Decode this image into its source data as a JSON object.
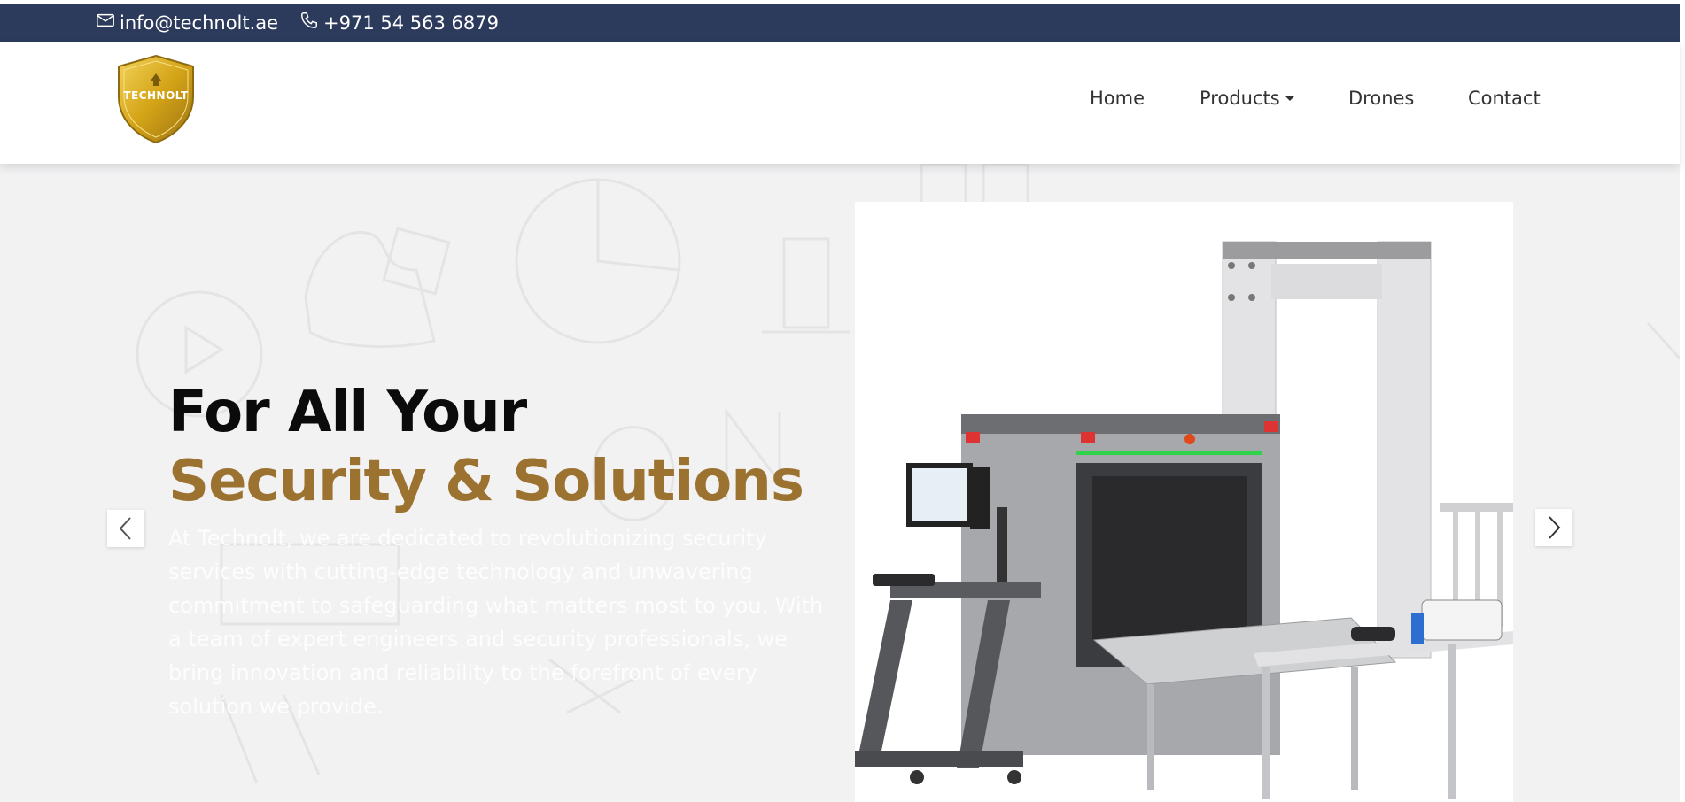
{
  "topbar": {
    "email": "info@technolt.ae",
    "phone": "+971 54 563 6879"
  },
  "logo": {
    "text": "TECHNOLT"
  },
  "nav": {
    "home": "Home",
    "products": "Products",
    "drones": "Drones",
    "contact": "Contact"
  },
  "hero": {
    "headline_line1": "For All Your",
    "headline_line2": "Security & Solutions",
    "description": "At Technolt, we are dedicated to revolutionizing security services with cutting-edge technology and unwavering commitment to safeguarding what matters most to you. With a team of expert engineers and security professionals, we bring innovation and reliability to the forefront of every solution we provide."
  },
  "colors": {
    "topbar_bg": "#2c3a5c",
    "accent_gold": "#9b7230",
    "hero_bg": "#f2f2f3"
  },
  "icons": {
    "email": "envelope-icon",
    "phone": "phone-icon",
    "prev": "chevron-left-icon",
    "next": "chevron-right-icon"
  }
}
